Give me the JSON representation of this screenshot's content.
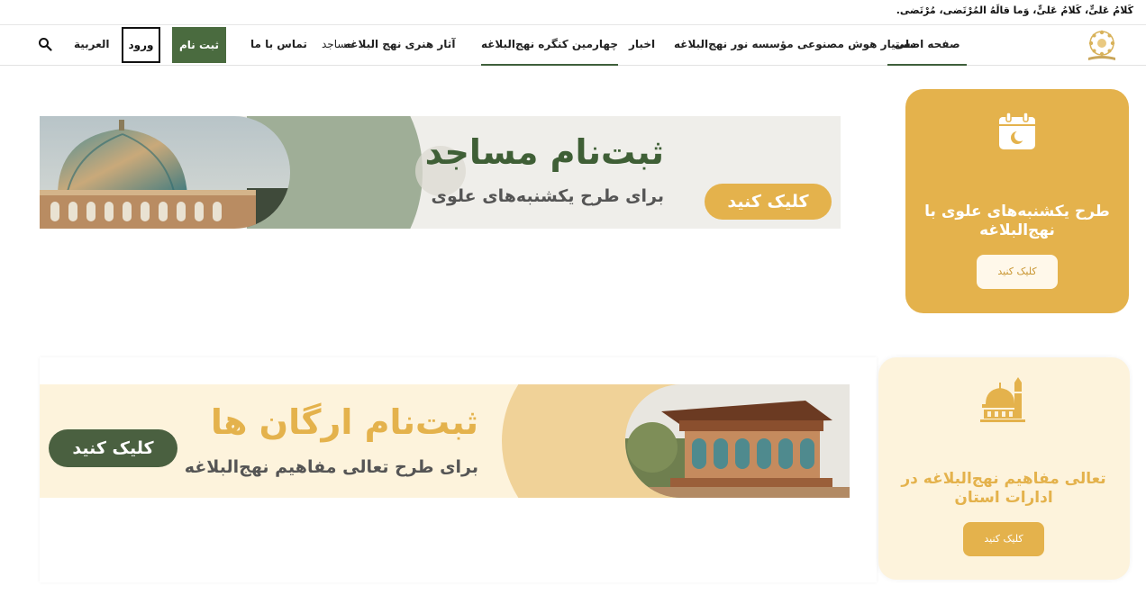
{
  "topbar": {
    "quote": "کَلامُ عَلیٍّ، کَلامُ عَلیٍّ، وَما قالَهُ المُرْتَضی، مُرْتَضی."
  },
  "nav": {
    "items": [
      "صفحه اصلی",
      "دستیار هوش مصنوعی مؤسسه نور نهج‌البلاغه",
      "اخبار",
      "چهارمین کنگره نهج‌البلاغه",
      "آثار هنری نهج البلاغه",
      "مساجد",
      "تماس با ما"
    ],
    "register": "ثبت نام",
    "login": "ورود",
    "language": "العربية"
  },
  "banner_mosques": {
    "title": "ثبت‌نام مساجد",
    "subtitle": "برای طرح یکشنبه‌های علوی",
    "cta": "کلیک کنید"
  },
  "card_sundays": {
    "icon": "calendar-crescent-icon",
    "title": "طرح یکشنبه‌های علوی با نهج‌البلاغه",
    "button": "کلیک کنید"
  },
  "banner_orgs": {
    "title": "ثبت‌نام ارگان ها",
    "subtitle": "برای طرح تعالی مفاهیم نهج‌البلاغه",
    "cta": "کلیک کنید"
  },
  "card_offices": {
    "icon": "mosque-icon",
    "title": "تعالی مفاهیم نهج‌البلاغه در ادارات استان",
    "button": "کلیک کنید"
  },
  "colors": {
    "primary_green": "#4a6b3f",
    "gold": "#e4b24c",
    "cream": "#fdf3dc"
  }
}
